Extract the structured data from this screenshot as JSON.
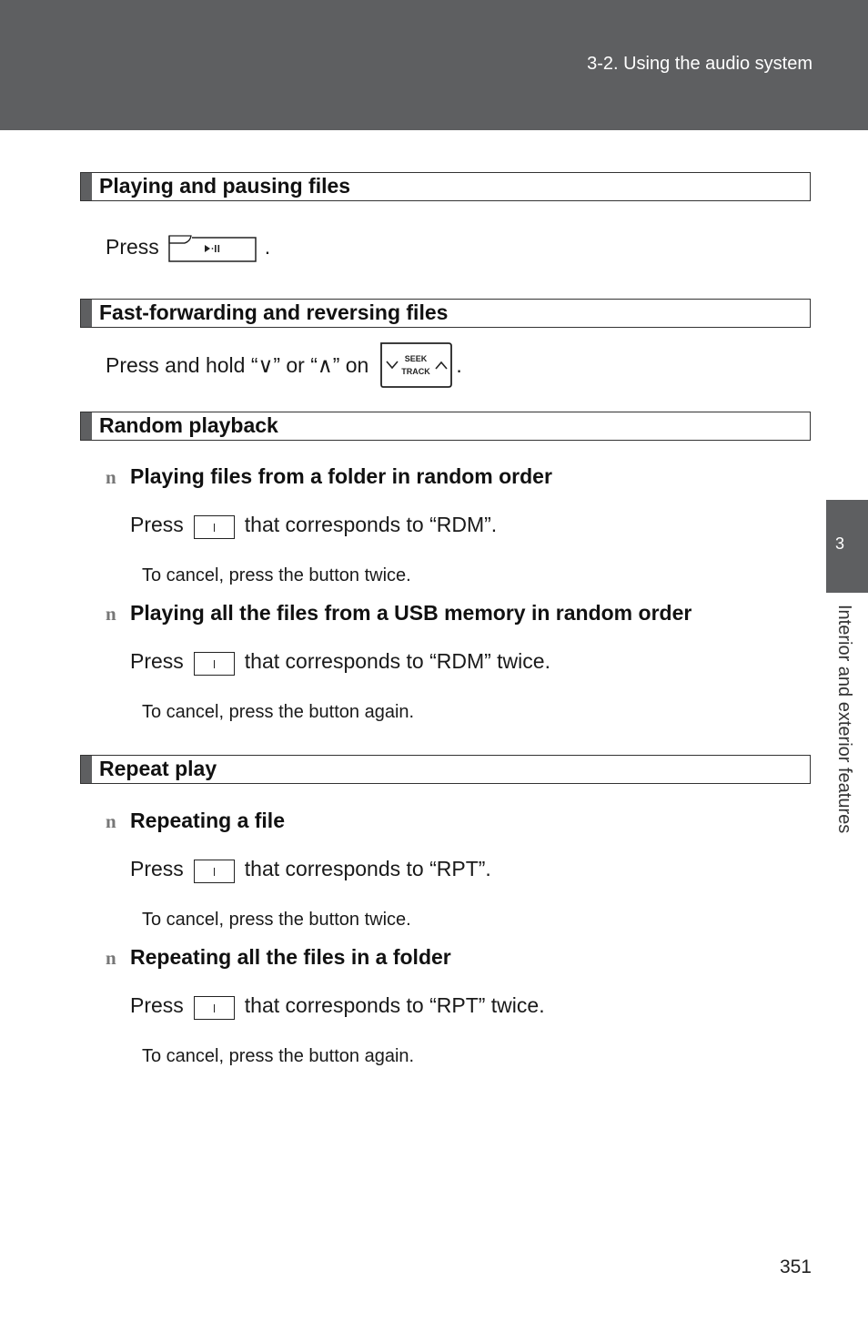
{
  "header": {
    "title": "3-2. Using the audio system"
  },
  "side_tab": {
    "number": "3",
    "label": "Interior and exterior features"
  },
  "page_number": "351",
  "icons": {
    "play_pause_key": "play-pause-button-glyph",
    "seek_track_key": "seek-track-rocker",
    "preset_key": "preset-button-glyph",
    "bullet": "n"
  },
  "sections": {
    "play_pause": {
      "title": "Playing and pausing files",
      "press": "Press",
      "play_pause_glyph": "▶·II",
      "period": "."
    },
    "ff_rev": {
      "title": "Fast-forwarding and reversing files",
      "text": "Press and hold “∨” or “∧” on",
      "seek_label": "SEEK",
      "track_label": "TRACK",
      "period": "."
    },
    "random": {
      "title": "Random playback",
      "items": [
        {
          "bullet": "n",
          "heading": "Playing files from a folder in random order",
          "press": "Press",
          "after": "that corresponds to “RDM”.",
          "note": "To cancel, press the button twice."
        },
        {
          "bullet": "n",
          "heading": "Playing all the files from a USB memory in random order",
          "press": "Press",
          "after": "that corresponds to “RDM” twice.",
          "note": "To cancel, press the button again."
        }
      ]
    },
    "repeat": {
      "title": "Repeat play",
      "items": [
        {
          "bullet": "n",
          "heading": "Repeating a file",
          "press": "Press",
          "after": "that corresponds to “RPT”.",
          "note": "To cancel, press the button twice."
        },
        {
          "bullet": "n",
          "heading": "Repeating all the files in a folder",
          "press": "Press",
          "after": "that corresponds to “RPT” twice.",
          "note": "To cancel, press the button again."
        }
      ]
    }
  }
}
